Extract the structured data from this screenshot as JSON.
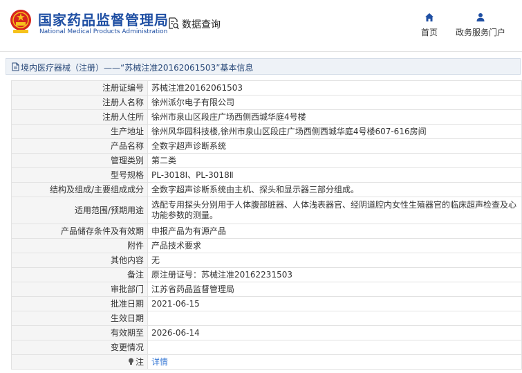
{
  "header": {
    "logo_cn": "国家药品监督管理局",
    "logo_en": "National Medical Products Administration",
    "query_label": "数据查询",
    "nav": [
      {
        "label": "首页",
        "icon": "home-icon"
      },
      {
        "label": "政务服务门户",
        "icon": "user-icon"
      }
    ]
  },
  "breadcrumb": {
    "icon": "document-icon",
    "text": "境内医疗器械（注册）——“苏械注准20162061503”基本信息"
  },
  "details": {
    "rows": [
      {
        "label": "注册证编号",
        "value": "苏械注准20162061503"
      },
      {
        "label": "注册人名称",
        "value": "徐州派尔电子有限公司"
      },
      {
        "label": "注册人住所",
        "value": "徐州市泉山区段庄广场西侧西城华庭4号楼"
      },
      {
        "label": "生产地址",
        "value": "徐州风华园科技楼,徐州市泉山区段庄广场西侧西城华庭4号楼607-616房间"
      },
      {
        "label": "产品名称",
        "value": "全数字超声诊断系统"
      },
      {
        "label": "管理类别",
        "value": "第二类"
      },
      {
        "label": "型号规格",
        "value": "PL-3018Ⅰ、PL-3018Ⅱ"
      },
      {
        "label": "结构及组成/主要组成成分",
        "value": "全数字超声诊断系统由主机、探头和显示器三部分组成。"
      },
      {
        "label": "适用范围/预期用途",
        "value": "选配专用探头分别用于人体腹部脏器、人体浅表器官、经阴道腔内女性生殖器官的临床超声检查及心功能参数的测量。"
      },
      {
        "label": "产品储存条件及有效期",
        "value": "申报产品为有源产品"
      },
      {
        "label": "附件",
        "value": "产品技术要求"
      },
      {
        "label": "其他内容",
        "value": "无"
      },
      {
        "label": "备注",
        "value": "原注册证号：苏械注准20162231503"
      },
      {
        "label": "审批部门",
        "value": "江苏省药品监督管理局"
      },
      {
        "label": "批准日期",
        "value": "2021-06-15"
      },
      {
        "label": "生效日期",
        "value": ""
      },
      {
        "label": "有效期至",
        "value": "2026-06-14"
      },
      {
        "label": "变更情况",
        "value": ""
      }
    ],
    "note": {
      "label": "注",
      "icon": "lightbulb-icon",
      "link": "详情"
    }
  },
  "colors": {
    "brand_blue": "#1f4fa3",
    "emblem_red": "#d7261e",
    "link": "#3b7bd6"
  }
}
